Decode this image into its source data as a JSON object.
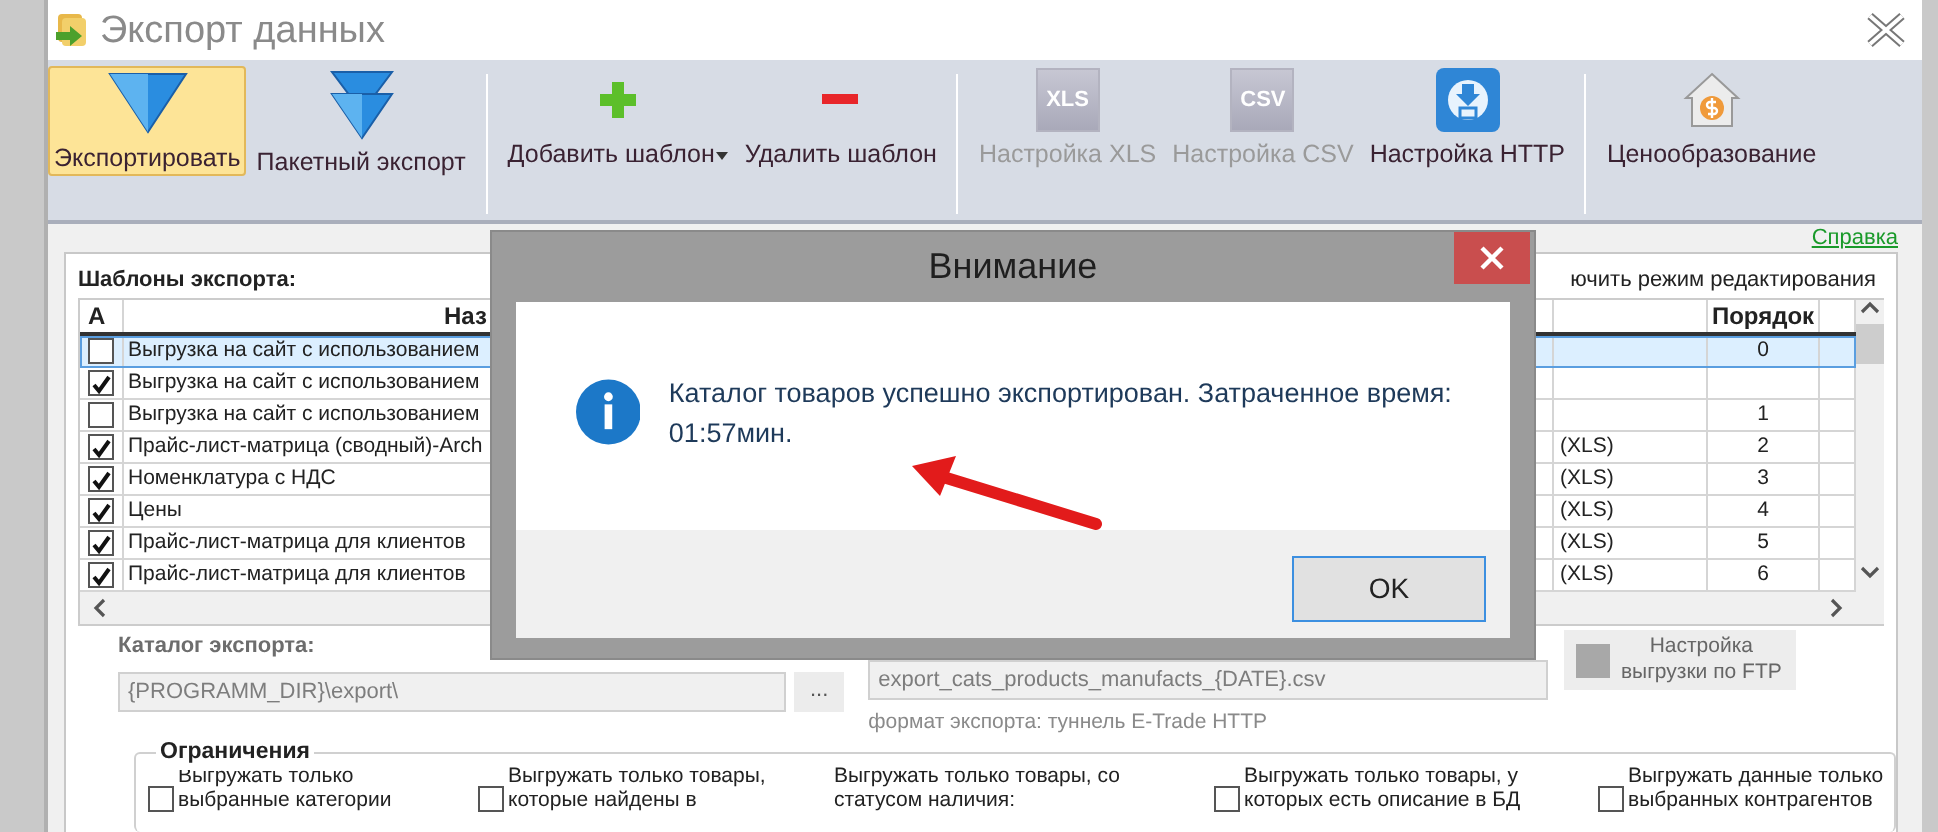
{
  "window": {
    "title": "Экспорт данных"
  },
  "toolbar": [
    {
      "label": "Экспортировать",
      "selected": true,
      "disabled": false,
      "dropdown": false
    },
    {
      "label": "Пакетный экспорт",
      "selected": false,
      "disabled": false,
      "dropdown": false
    },
    {
      "kind": "separator"
    },
    {
      "label": "Добавить шаблон",
      "selected": false,
      "disabled": false,
      "dropdown": true
    },
    {
      "label": "Удалить шаблон",
      "selected": false,
      "disabled": false,
      "dropdown": false
    },
    {
      "kind": "separator"
    },
    {
      "label": "Настройка XLS",
      "icon_text": "XLS",
      "selected": false,
      "disabled": true,
      "dropdown": false
    },
    {
      "label": "Настройка CSV",
      "icon_text": "CSV",
      "selected": false,
      "disabled": true,
      "dropdown": false
    },
    {
      "label": "Настройка HTTP",
      "selected": false,
      "disabled": false,
      "dropdown": false
    },
    {
      "kind": "separator"
    },
    {
      "label": "Ценообразование",
      "selected": false,
      "disabled": false,
      "dropdown": false
    }
  ],
  "help_link": "Справка",
  "templates": {
    "title": "Шаблоны экспорта:",
    "edit_mode_label": "ючить режим редактирования",
    "columns": [
      "A",
      "Наз",
      "Порядок"
    ],
    "rows": [
      {
        "checked": false,
        "name": "Выгрузка на сайт с использованием",
        "order": "0",
        "selected": true
      },
      {
        "checked": true,
        "name": "Выгрузка на сайт с использованием",
        "selected": false
      },
      {
        "checked": false,
        "name": "Выгрузка на сайт с использованием",
        "order": "1",
        "selected": false
      },
      {
        "checked": true,
        "name": "Прайс-лист-матрица (сводный)-Arch",
        "format": "(XLS)",
        "order": "2",
        "selected": false
      },
      {
        "checked": true,
        "name": "Номенклатура с НДС",
        "format": "(XLS)",
        "order": "3",
        "selected": false
      },
      {
        "checked": true,
        "name": "Цены",
        "format": "(XLS)",
        "order": "4",
        "selected": false
      },
      {
        "checked": true,
        "name": "Прайс-лист-матрица для клиентов",
        "format": "(XLS)",
        "order": "5",
        "selected": false
      },
      {
        "checked": true,
        "name": "Прайс-лист-матрица для клиентов",
        "format": "(XLS)",
        "order": "6",
        "selected": false
      }
    ]
  },
  "export": {
    "catalog_label": "Каталог экспорта:",
    "catalog_path": "{PROGRAMM_DIR}\\export\\",
    "browse": "...",
    "filename": "export_cats_products_manufacts_{DATE}.csv",
    "format_note": "формат экспорта: туннель E-Trade HTTP",
    "ftp_button": "Настройка выгрузки по FTP"
  },
  "restrictions": {
    "title": "Ограничения",
    "items": [
      {
        "kind": "checkbox",
        "label": "Выгружать только выбранные категории",
        "checked": false
      },
      {
        "kind": "checkbox",
        "label": "Выгружать только товары, которые найдены в",
        "checked": false
      },
      {
        "kind": "text",
        "label": "Выгружать только товары, со статусом наличия:"
      },
      {
        "kind": "checkbox",
        "label": "Выгружать только товары, у которых есть описание в БД",
        "checked": false
      },
      {
        "kind": "checkbox",
        "label": "Выгружать данные только выбранных контрагентов",
        "checked": false
      }
    ]
  },
  "dialog": {
    "title": "Внимание",
    "message": "Каталог товаров успешно экспортирован. Затраченное время: 01:57мин.",
    "button": "OK"
  }
}
